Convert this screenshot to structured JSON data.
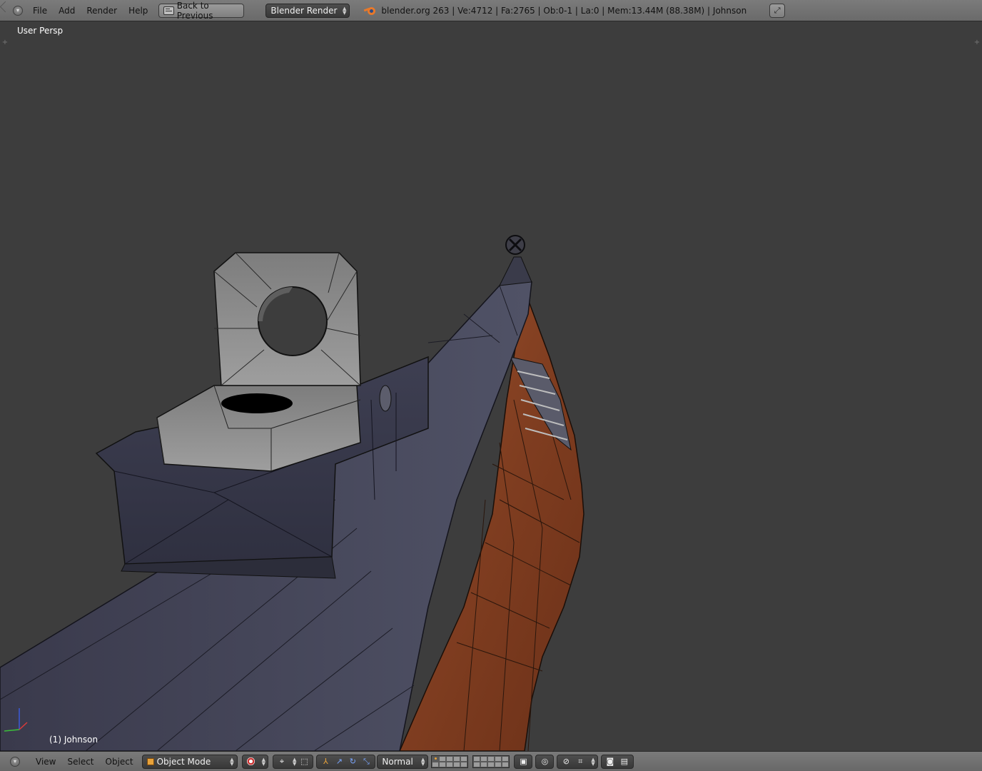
{
  "header": {
    "menus": [
      "File",
      "Add",
      "Render",
      "Help"
    ],
    "back_button": "Back to Previous",
    "render_engine": "Blender Render",
    "stats": "blender.org 263 | Ve:4712 | Fa:2765 | Ob:0-1 | La:0 | Mem:13.44M (88.38M) | Johnson"
  },
  "viewport": {
    "view_label": "User Persp",
    "object_label": "(1) Johnson"
  },
  "footer": {
    "menus": [
      "View",
      "Select",
      "Object"
    ],
    "mode": "Object Mode",
    "orientation": "Normal"
  },
  "colors": {
    "viewport_bg": "#3d3d3d",
    "header_bg": "#727272",
    "metal": "#4a4a5c",
    "wood": "#8a4426",
    "sight": "#8a8a8a"
  },
  "icons": {
    "back": "screen-back-icon",
    "logo": "blender-logo-icon",
    "fullscreen": "fullscreen-icon",
    "mode": "object-cube-icon",
    "pivot": "pivot-icon",
    "snap": "magnet-icon",
    "render": "render-camera-icon"
  }
}
